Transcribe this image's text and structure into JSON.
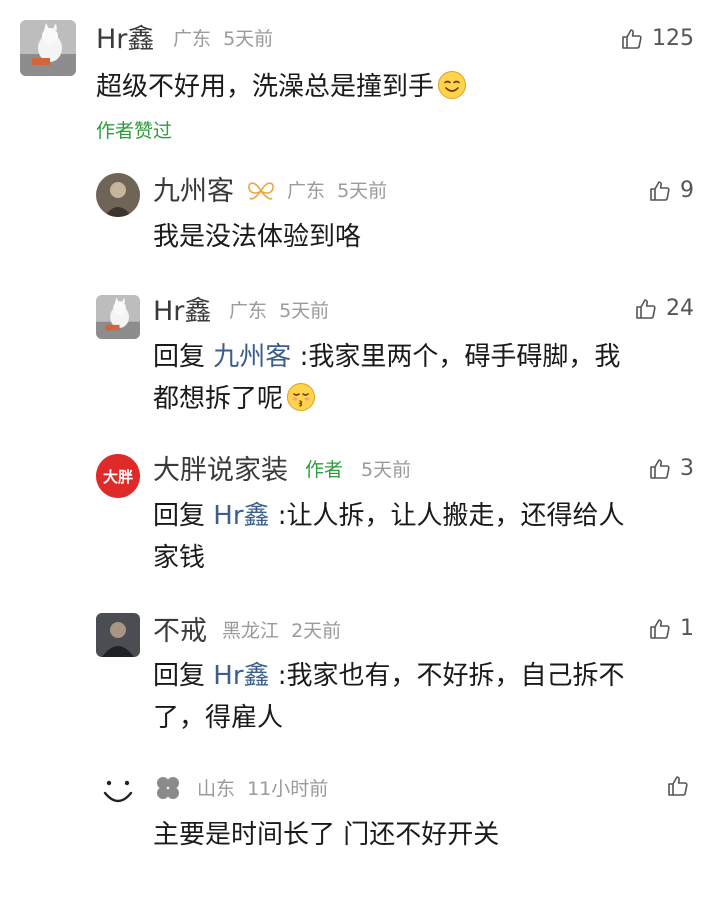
{
  "comments": [
    {
      "user": "Hr鑫",
      "location": "广东",
      "time": "5天前",
      "likes": "125",
      "text": "超级不好用，洗澡总是撞到手",
      "author_liked": "作者赞过"
    },
    {
      "user": "九州客",
      "location": "广东",
      "time": "5天前",
      "likes": "9",
      "text": "我是没法体验到咯"
    },
    {
      "user": "Hr鑫",
      "location": "广东",
      "time": "5天前",
      "likes": "24",
      "reply_prefix": "回复",
      "reply_to": "九州客",
      "line1": ":我家里两个，碍手碍脚，我",
      "line2": "都想拆了呢"
    },
    {
      "user": "大胖说家装",
      "author_tag": "作者",
      "time": "5天前",
      "likes": "3",
      "reply_prefix": "回复",
      "reply_to": "Hr鑫",
      "line1": ":让人拆，让人搬走，还得给人",
      "line2": "家钱",
      "avatar_text": "大胖"
    },
    {
      "user": "不戒",
      "location": "黑龙江",
      "time": "2天前",
      "likes": "1",
      "reply_prefix": "回复",
      "reply_to": "Hr鑫",
      "line1": ":我家也有，不好拆，自己拆不",
      "line2": "了，得雇人"
    },
    {
      "location": "山东",
      "time": "11小时前",
      "text": "主要是时间长了  门还不好开关"
    }
  ],
  "colors": {
    "link": "#3b5f8a",
    "author_green": "#2e9e3d",
    "meta_gray": "#9a9a9a"
  }
}
